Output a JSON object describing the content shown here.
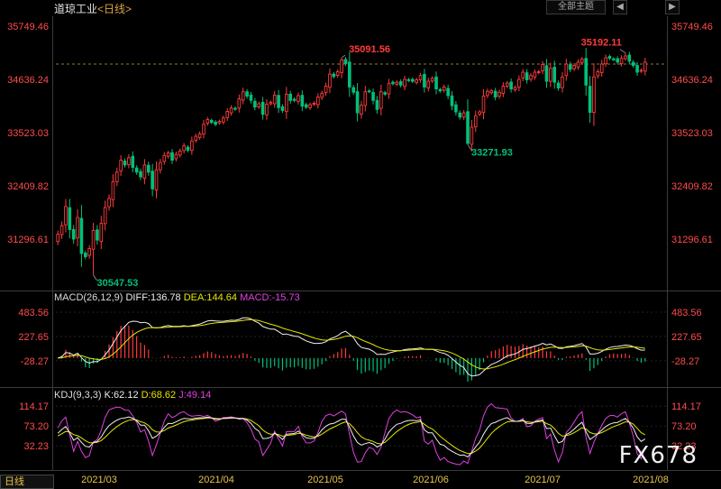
{
  "header": {
    "title": "道琼工业",
    "period": "<日线>",
    "btn_theme": "全部主题",
    "btn_prev": "◀",
    "btn_next": "▶"
  },
  "period_tab": "日线",
  "watermark": "FX678",
  "colors": {
    "up": "#ff3b3b",
    "down": "#00c07a",
    "diff": "#f0f0f0",
    "dea": "#e6e600",
    "kdj_k": "#f0f0f0",
    "kdj_d": "#e6e600",
    "kdj_j": "#e040e0",
    "price_axis": "#ff4b4b"
  },
  "chart_data": [
    {
      "type": "candlestick",
      "title": "道琼工业 <日线>",
      "y_ticks": [
        "35749.46",
        "34636.24",
        "33523.03",
        "32409.82",
        "31296.61"
      ],
      "ylim": [
        30300,
        35960
      ],
      "x_ticks": [
        "2021/03",
        "2021/04",
        "2021/05",
        "2021/06",
        "2021/07",
        "2021/08"
      ],
      "reference_line": 34960,
      "annotations": [
        {
          "label": "35091.56",
          "value": 35091.56,
          "bar": 72
        },
        {
          "label": "35192.11",
          "value": 35192.11,
          "bar": 144
        },
        {
          "label": "33271.93",
          "value": 33271.93,
          "bar": 104
        },
        {
          "label": "30547.53",
          "value": 30547.53,
          "bar": 9
        }
      ],
      "closes": [
        31400,
        31580,
        31980,
        31500,
        31300,
        31750,
        31000,
        30930,
        31100,
        31480,
        31280,
        31630,
        31960,
        32150,
        32500,
        32700,
        32950,
        32850,
        33000,
        32800,
        32700,
        32600,
        32850,
        32700,
        32350,
        32750,
        32900,
        33050,
        33100,
        32950,
        33070,
        33140,
        33250,
        33160,
        33350,
        33450,
        33500,
        33700,
        33800,
        33740,
        33700,
        33760,
        33830,
        33970,
        34040,
        34020,
        34230,
        34380,
        34290,
        34200,
        34060,
        34130,
        33910,
        34120,
        34160,
        34310,
        34050,
        33990,
        34330,
        34200,
        34200,
        34300,
        34080,
        34060,
        34110,
        34140,
        34270,
        34350,
        34500,
        34750,
        34700,
        34800,
        35050,
        34970,
        34480,
        34370,
        33940,
        34100,
        34380,
        34390,
        34200,
        34010,
        34380,
        34330,
        34550,
        34550,
        34580,
        34520,
        34640,
        34620,
        34600,
        34630,
        34720,
        34480,
        34600,
        34660,
        34440,
        34400,
        34480,
        34300,
        34090,
        33960,
        33850,
        33940,
        33300,
        33640,
        33880,
        33960,
        34290,
        34390,
        34400,
        34270,
        34370,
        34500,
        34560,
        34440,
        34470,
        34640,
        34790,
        34630,
        34720,
        34790,
        34800,
        34950,
        34600,
        34870,
        34580,
        34460,
        34690,
        34960,
        34850,
        34930,
        35000,
        35060,
        34520,
        33950,
        34690,
        34800,
        34960,
        35090,
        35080,
        35060,
        35000,
        35080,
        35130,
        35020,
        34930,
        34790,
        34830,
        35000
      ]
    },
    {
      "type": "line",
      "title": "MACD(26,12,9)",
      "legend": [
        "DIFF:136.78",
        "DEA:144.64",
        "MACD:-15.73"
      ],
      "y_ticks": [
        "483.56",
        "227.65",
        "-28.27"
      ],
      "ylim": [
        -220,
        560
      ]
    },
    {
      "type": "line",
      "title": "KDJ(9,3,3)",
      "legend": [
        "K:62.12",
        "D:68.62",
        "J:49.14"
      ],
      "y_ticks": [
        "114.17",
        "73.20",
        "32.23"
      ],
      "ylim": [
        -12,
        122
      ]
    }
  ]
}
